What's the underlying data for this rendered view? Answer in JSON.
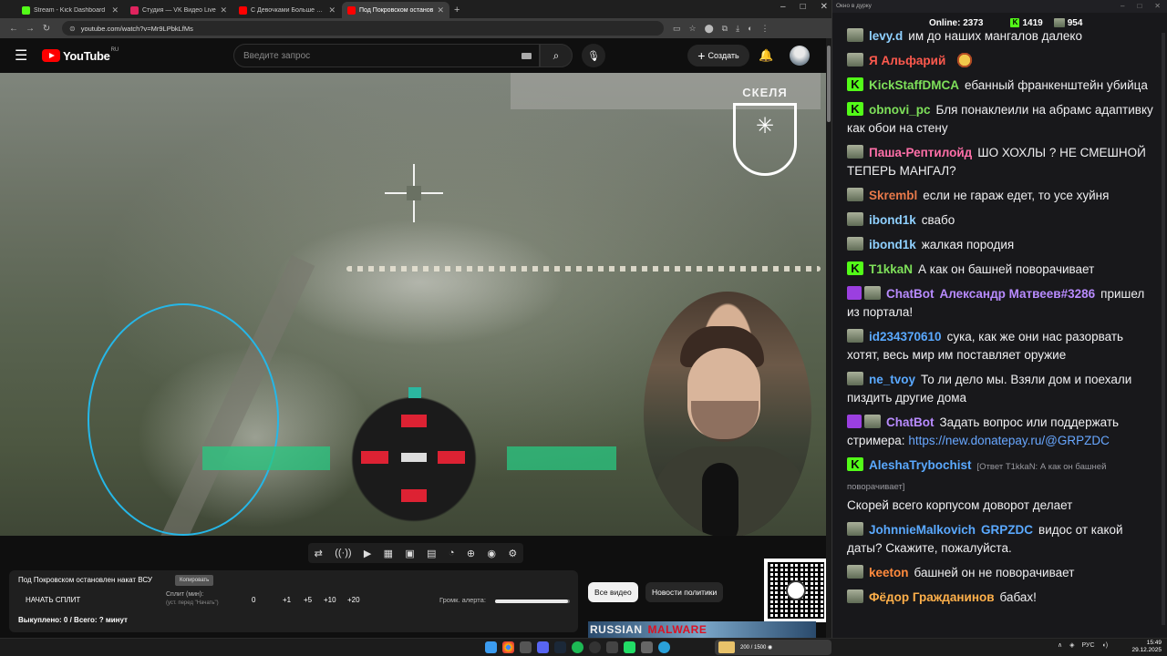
{
  "browser": {
    "tabs": [
      {
        "label": "Stream - Kick Dashboard",
        "favicon_color": "#53fc18",
        "active": false
      },
      {
        "label": "Студия — VK Видео Live",
        "favicon_color": "#e0245e",
        "active": false
      },
      {
        "label": "С Девочками Больше Не Хоч",
        "favicon_color": "#ff0000",
        "active": false
      },
      {
        "label": "Под Покровском останов",
        "favicon_color": "#ff0000",
        "active": true
      }
    ],
    "new_tab_label": "+",
    "url": "youtube.com/watch?v=Mr9LPbkLfMs",
    "window_controls": [
      "–",
      "□",
      "✕"
    ]
  },
  "youtube": {
    "logo_text": "YouTube",
    "logo_country": "RU",
    "search_placeholder": "Введите запрос",
    "create_label": "Создать"
  },
  "video": {
    "watermark_text": "СКЕЛЯ"
  },
  "player_tools": [
    "⇄",
    "((·))",
    "▶",
    "▦",
    "▣",
    "▤",
    "◔",
    "⊕",
    "◉",
    "⚙"
  ],
  "alert_panel": {
    "title": "Под Покровском остановлен накат ВСУ",
    "copy_label": "Копировать",
    "start_split_label": "НАЧАТЬ СПЛИТ",
    "split_label": "Сплит (мин):",
    "split_sub": "(уст. перед \"Начать\")",
    "split_value": "0",
    "add_buttons": [
      "+1",
      "+5",
      "+10",
      "+20"
    ],
    "volume_label": "Громк. алерта:",
    "volume_level": 0.98,
    "stats": "Выкуплено: 0 / Всего: ? минут"
  },
  "chips": {
    "all_videos": "Все видео",
    "politics_news": "Новости политики"
  },
  "ad_banner": {
    "word1": "RUSSIAN",
    "word2": "MALWARE"
  },
  "chat": {
    "window_title": "Окно в дурку",
    "online_label": "Online:",
    "online_count": "2373",
    "kick_count": "1419",
    "twitch_count": "954",
    "messages": [
      {
        "badge": "tw",
        "user": "levy.d",
        "color": "#8fd0ff",
        "text": "им до наших мангалов далеко"
      },
      {
        "badge": "tw",
        "user": "Я Альфарий",
        "color": "#ff5a4e",
        "text": "",
        "emote": true
      },
      {
        "badge": "kick",
        "user": "KickStaffDMCA",
        "color": "#7ee05a",
        "text": "ебанный франкенштейн убийца"
      },
      {
        "badge": "kick",
        "user": "obnovi_pc",
        "color": "#7ee05a",
        "text": "Бля понаклеили на абрамс адаптивку как обои на стену"
      },
      {
        "badge": "tw",
        "user": "Паша-Рептилойд",
        "color": "#ff6fa8",
        "text": "ШО ХОХЛЫ ? НЕ СМЕШНОЙ ТЕПЕРЬ МАНГАЛ?"
      },
      {
        "badge": "tw",
        "user": "Skrembl",
        "color": "#e8794a",
        "text": "если не гараж едет, то усе хуйня"
      },
      {
        "badge": "tw",
        "user": "ibond1k",
        "color": "#8fd0ff",
        "text": "свабо"
      },
      {
        "badge": "tw",
        "user": "ibond1k",
        "color": "#8fd0ff",
        "text": "жалкая породия"
      },
      {
        "badge": "kick",
        "user": "T1kkaN",
        "color": "#7ee05a",
        "text": "А как он башней поворачивает"
      },
      {
        "badge": "bot",
        "user": "ChatBot",
        "color": "#b88bff",
        "prefix": "Александр Матвеев#3286",
        "text": "пришел из портала!"
      },
      {
        "badge": "tw",
        "user": "id234370610",
        "color": "#5aa9ff",
        "text": "сука, как же они нас разорвать хотят, весь мир им поставляет оружие"
      },
      {
        "badge": "tw",
        "user": "ne_tvoy",
        "color": "#5aa9ff",
        "text": "То ли дело мы. Взяли дом и поехали пиздить другие дома"
      },
      {
        "badge": "bot",
        "user": "ChatBot",
        "color": "#b88bff",
        "text": "Задать вопрос или поддержать стримера:",
        "link": "https://new.donatepay.ru/@GRPZDC"
      },
      {
        "badge": "kick",
        "user": "AleshaTrybochist",
        "color": "#5aa9ff",
        "reply": "[Ответ T1kkaN: А как он башней поворачивает]",
        "text": "Скорей всего корпусом доворот делает"
      },
      {
        "badge": "tw",
        "user": "JohnnieMalkovich",
        "color": "#5aa9ff",
        "prefix": "GRPZDC",
        "text": "видос от какой даты? Скажите, пожалуйста."
      },
      {
        "badge": "tw",
        "user": "keeton",
        "color": "#ff8a3d",
        "text": "башней он не поворачивает"
      },
      {
        "badge": "tw",
        "user": "Фёдор Гражданинов",
        "color": "#ffb04a",
        "text": "бабах!"
      }
    ]
  },
  "taskbar": {
    "widget_text": "200 / 1500 ◉",
    "lang": "РУС",
    "time": "15:49",
    "date": "29.12.2025"
  }
}
